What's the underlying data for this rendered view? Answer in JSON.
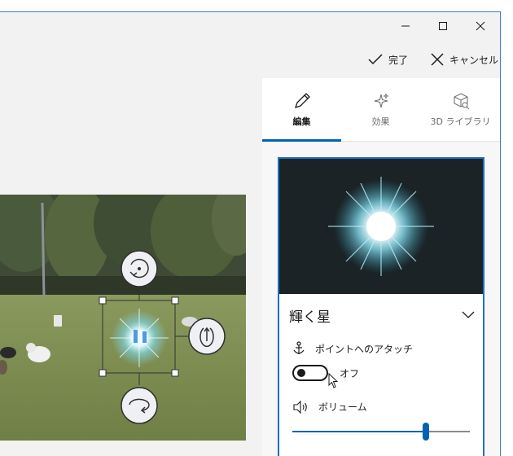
{
  "actions": {
    "done_label": "完了",
    "cancel_label": "キャンセル"
  },
  "tabs": [
    {
      "label": "編集",
      "icon": "pencil-icon",
      "active": true
    },
    {
      "label": "効果",
      "icon": "sparkle-icon",
      "active": false
    },
    {
      "label": "3D ライブラリ",
      "icon": "3d-cube-icon",
      "active": false
    }
  ],
  "effect": {
    "name": "輝く星",
    "anchor_label": "ポイントへのアタッチ",
    "toggle_state_label": "オフ",
    "toggle_on": false,
    "volume_label": "ボリューム",
    "volume_level": 0.75
  },
  "colors": {
    "accent": "#0063b1",
    "card_border": "#1e6fc4",
    "window_border": "#3a7fd0"
  }
}
